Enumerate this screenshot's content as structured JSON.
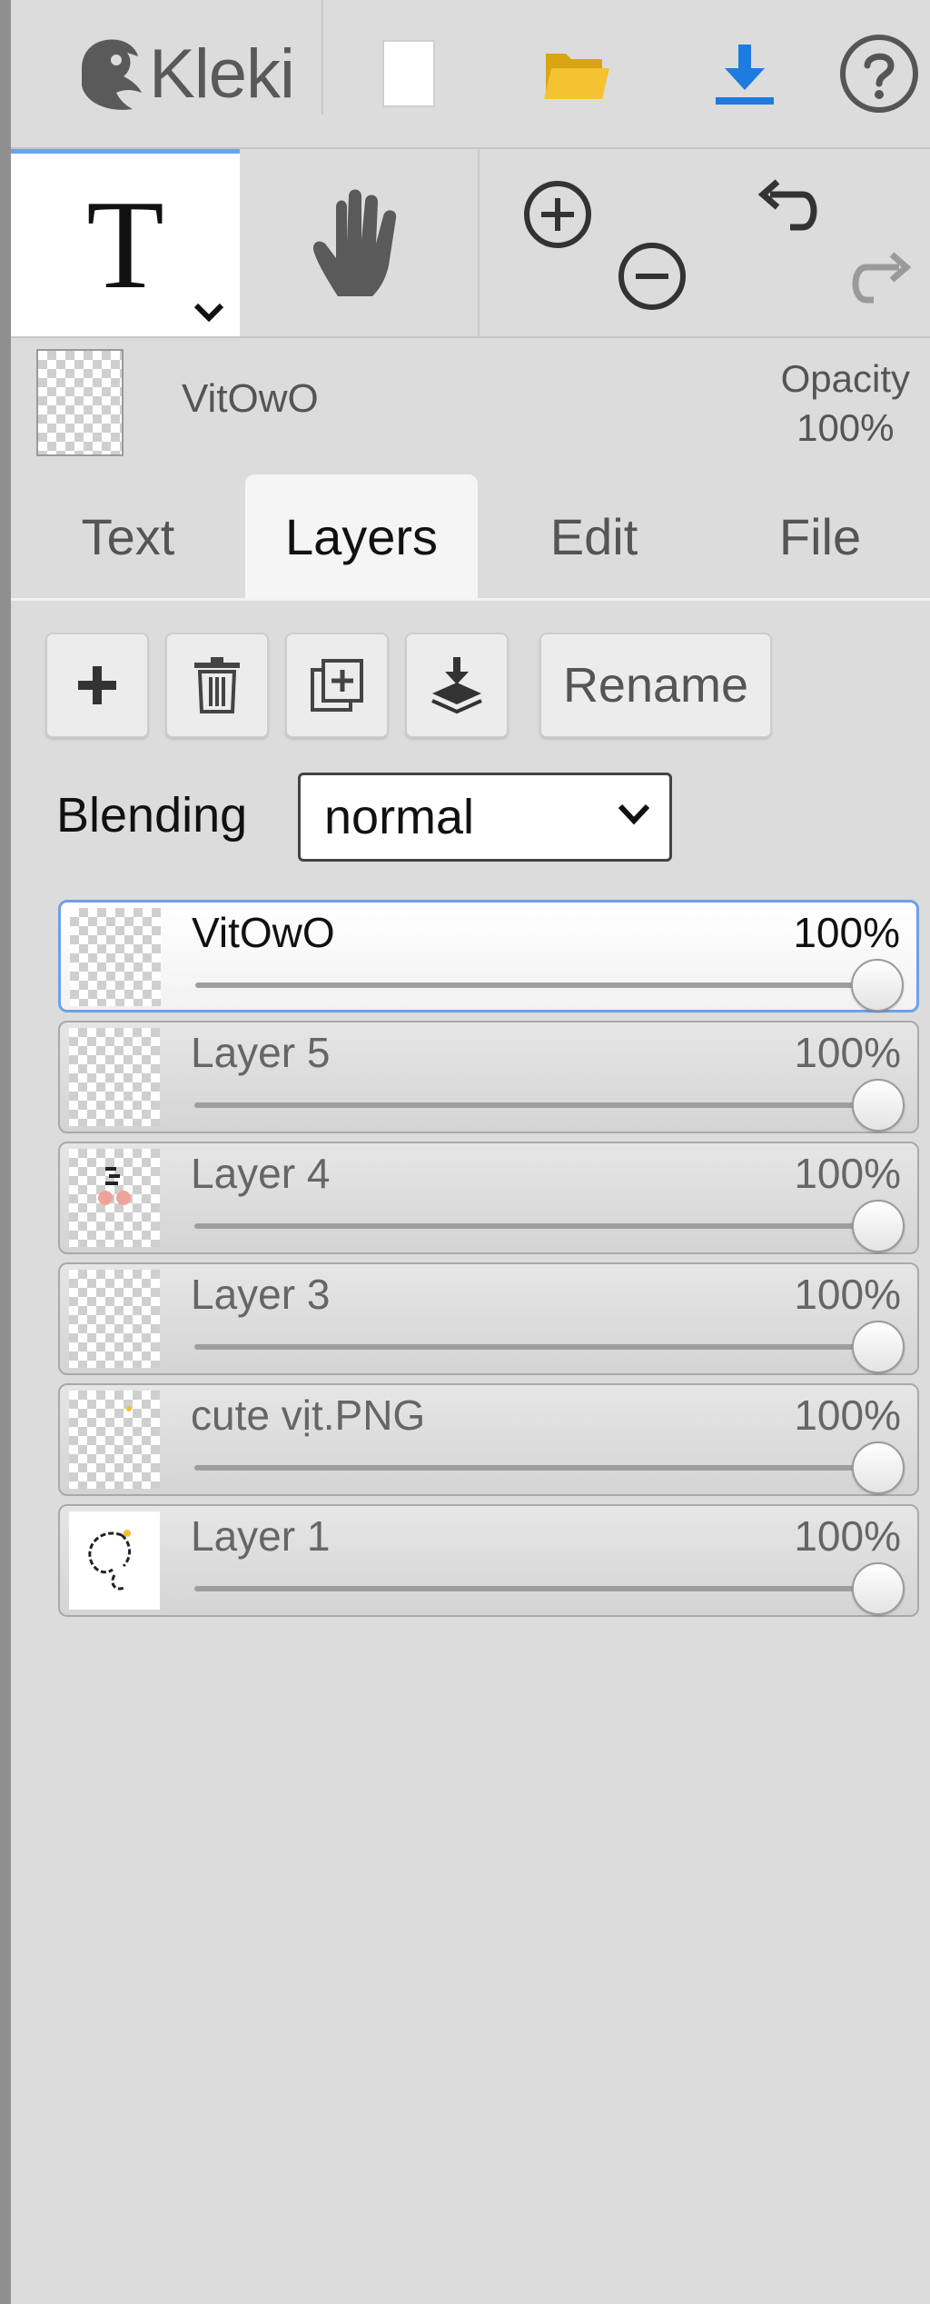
{
  "app": {
    "name": "Kleki"
  },
  "topbar": {
    "new_icon": "new-file-icon",
    "open_icon": "folder-icon",
    "save_icon": "download-icon",
    "help_icon": "help-icon"
  },
  "tools": {
    "text_tool": "T",
    "hand_tool": "hand-icon",
    "zoom_in": "zoom-in-icon",
    "zoom_out": "zoom-out-icon",
    "undo": "undo-icon",
    "redo": "redo-icon"
  },
  "current_layer": {
    "name": "VitOwO",
    "opacity_label": "Opacity",
    "opacity_value": "100%"
  },
  "tabs": [
    {
      "label": "Text",
      "active": false
    },
    {
      "label": "Layers",
      "active": true
    },
    {
      "label": "Edit",
      "active": false
    },
    {
      "label": "File",
      "active": false
    }
  ],
  "layers_panel": {
    "rename_label": "Rename",
    "blending_label": "Blending",
    "blending_value": "normal",
    "layers": [
      {
        "name": "VitOwO",
        "opacity": "100%",
        "selected": true
      },
      {
        "name": "Layer 5",
        "opacity": "100%",
        "selected": false
      },
      {
        "name": "Layer 4",
        "opacity": "100%",
        "selected": false
      },
      {
        "name": "Layer 3",
        "opacity": "100%",
        "selected": false
      },
      {
        "name": "cute vịt.PNG",
        "opacity": "100%",
        "selected": false
      },
      {
        "name": "Layer 1",
        "opacity": "100%",
        "selected": false
      }
    ]
  },
  "colors": {
    "accent": "#6ea3e6",
    "download": "#1e7be0",
    "folder": "#f2c12e"
  }
}
